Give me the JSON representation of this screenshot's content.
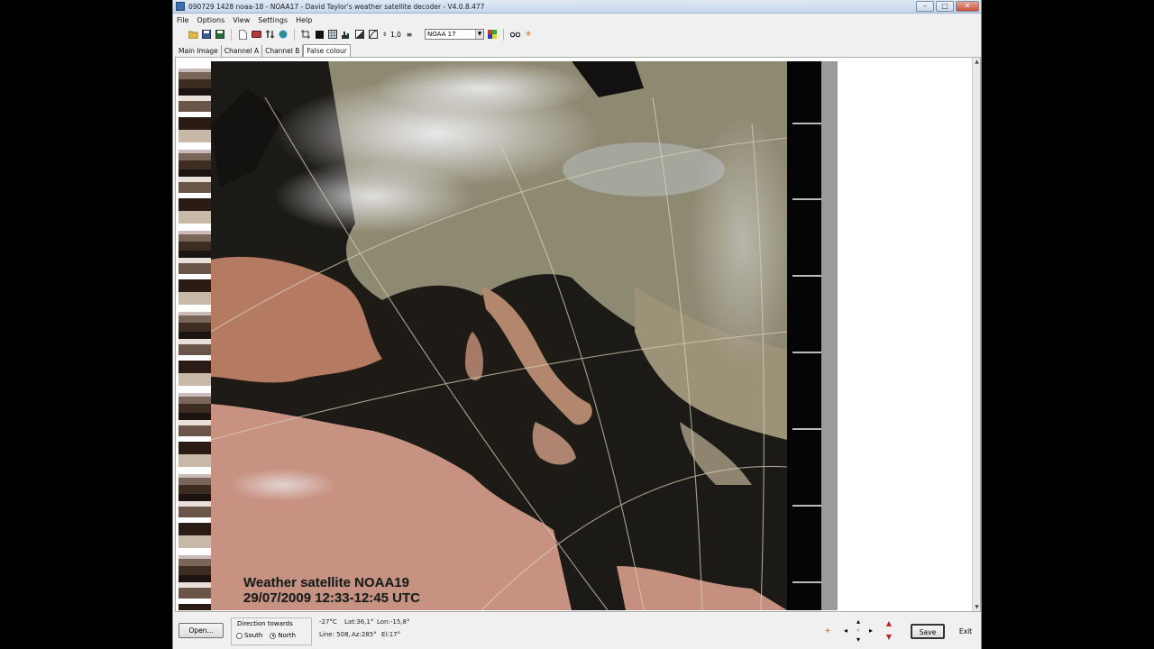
{
  "window": {
    "title": "090729 1428 noaa-18 - NOAA17 - David Taylor's weather satellite decoder - V4.0.8.477",
    "minimize": "–",
    "maximize": "□",
    "close": "✕"
  },
  "menu": [
    "File",
    "Options",
    "View",
    "Settings",
    "Help"
  ],
  "toolbar": {
    "gamma_value": "1,0",
    "satellite_select": "NOAA 17"
  },
  "tabs": [
    "Main Image",
    "Channel A",
    "Channel B",
    "False colour"
  ],
  "active_tab": "False colour",
  "image": {
    "caption_line1": "Weather satellite NOAA19",
    "caption_line2": "29/07/2009  12:33-12:45  UTC"
  },
  "bottom": {
    "open_button": "Open...",
    "direction_label": "Direction towards",
    "south_label": "South",
    "north_label": "North",
    "direction_selected": "North",
    "temperature": "-27°C",
    "lat": "Lat:36,1°",
    "lon": "Lon:-15,8°",
    "line": "Line: 508,",
    "az": "Az:285°",
    "el": "El:17°",
    "save_button": "Save",
    "exit_button": "Exit"
  }
}
